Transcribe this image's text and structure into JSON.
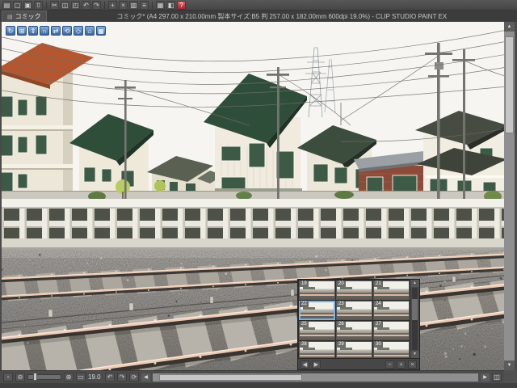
{
  "window": {
    "title": "コミック* (A4 297.00 x 210.00mm 製本サイズ:B5 判 257.00 x 182.00mm 600dpi 19.0%) - CLIP STUDIO PAINT EX",
    "tab_label": "コミック",
    "tab_icon_glyph": "▤"
  },
  "glyphs": {
    "up": "▲",
    "down": "▼",
    "left": "◀",
    "right": "▶"
  },
  "top_toolbar": {
    "icons": [
      {
        "name": "new-page-icon",
        "glyph": "▤"
      },
      {
        "name": "open-file-icon",
        "glyph": "▢"
      },
      {
        "name": "save-icon",
        "glyph": "▣"
      },
      {
        "name": "export-icon",
        "glyph": "⇧"
      },
      {
        "name": "cut-icon",
        "glyph": "✂"
      },
      {
        "name": "copy-icon",
        "glyph": "◫"
      },
      {
        "name": "paste-icon",
        "glyph": "◰"
      },
      {
        "name": "undo-icon",
        "glyph": "↶"
      },
      {
        "name": "redo-icon",
        "glyph": "↷"
      },
      {
        "name": "add-page-icon",
        "glyph": "+"
      },
      {
        "name": "delete-page-icon",
        "glyph": "×"
      },
      {
        "name": "page-list-icon",
        "glyph": "▥"
      },
      {
        "name": "story-editor-icon",
        "glyph": "≡"
      },
      {
        "name": "grid-view-icon",
        "glyph": "▦"
      },
      {
        "name": "materials-icon",
        "glyph": "◧"
      },
      {
        "name": "help-icon",
        "glyph": "?"
      }
    ]
  },
  "canvas_toolbar": {
    "icons": [
      {
        "name": "camera-rotate-icon",
        "glyph": "↻"
      },
      {
        "name": "camera-pan-icon",
        "glyph": "⊞"
      },
      {
        "name": "camera-zoom-icon",
        "glyph": "⇕"
      },
      {
        "name": "camera-roll-icon",
        "glyph": "∩"
      },
      {
        "name": "object-move-icon",
        "glyph": "⇄"
      },
      {
        "name": "object-rotate-icon",
        "glyph": "⟲"
      },
      {
        "name": "object-scale-icon",
        "glyph": "◇"
      },
      {
        "name": "reset-camera-icon",
        "glyph": "⌂"
      },
      {
        "name": "perspective-grid-icon",
        "glyph": "▦"
      }
    ]
  },
  "materials_panel": {
    "items": [
      {
        "number": "19"
      },
      {
        "number": "20"
      },
      {
        "number": "21"
      },
      {
        "number": "22",
        "selected": true
      },
      {
        "number": "23"
      },
      {
        "number": "24"
      },
      {
        "number": "25"
      },
      {
        "number": "26"
      },
      {
        "number": "27"
      },
      {
        "number": "28"
      },
      {
        "number": "29"
      },
      {
        "number": "30"
      }
    ],
    "footer_icons": [
      {
        "name": "prev-material-icon",
        "glyph": "◀"
      },
      {
        "name": "next-material-icon",
        "glyph": "▶"
      },
      {
        "name": "zoom-out-thumbnail-icon",
        "glyph": "−"
      },
      {
        "name": "zoom-in-thumbnail-icon",
        "glyph": "+"
      },
      {
        "name": "delete-material-icon",
        "glyph": "×"
      }
    ]
  },
  "status_bar": {
    "icons_pre": [
      {
        "name": "view-options-icon",
        "glyph": "▫"
      },
      {
        "name": "zoom-out-icon",
        "glyph": "⊖"
      }
    ],
    "icons_post": [
      {
        "name": "zoom-in-icon",
        "glyph": "⊕"
      },
      {
        "name": "fit-view-icon",
        "glyph": "▭"
      }
    ],
    "zoom_value": "19.0",
    "icons_rotate": [
      {
        "name": "rotate-left-icon",
        "glyph": "↶"
      },
      {
        "name": "rotate-right-icon",
        "glyph": "↷"
      },
      {
        "name": "reset-rotation-icon",
        "glyph": "⟳"
      }
    ],
    "icons_right": [
      {
        "name": "palette-toggle-icon",
        "glyph": "◫"
      },
      {
        "name": "status-menu-icon",
        "glyph": "≡"
      }
    ]
  },
  "colors": {
    "sky": "#f6f5f1",
    "wall": "#ece7d8",
    "roof-green": "#2f4e3a",
    "roof-terracotta": "#b2572f",
    "brick": "#8c4a38",
    "window-green": "#3d5a47",
    "fence": "#f2f1ea",
    "rail": "#eec9b2",
    "ballast": "#76726b",
    "accent": "#7ab0e8"
  }
}
